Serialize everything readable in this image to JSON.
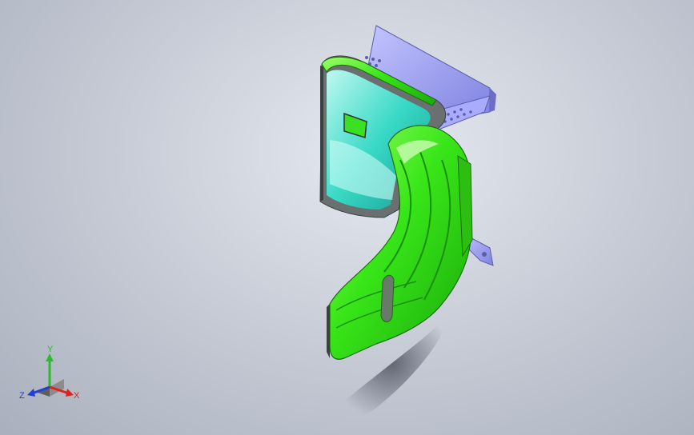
{
  "triad": {
    "x_label": "X",
    "y_label": "Y",
    "z_label": "Z"
  },
  "colors": {
    "part_green": "#39e61a",
    "bracket_blue": "#9a9cf2",
    "inner_cyan": "#3fe0cf",
    "axis_x": "#e0201c",
    "axis_y": "#2dbb2d",
    "axis_z": "#1f3fd8"
  }
}
